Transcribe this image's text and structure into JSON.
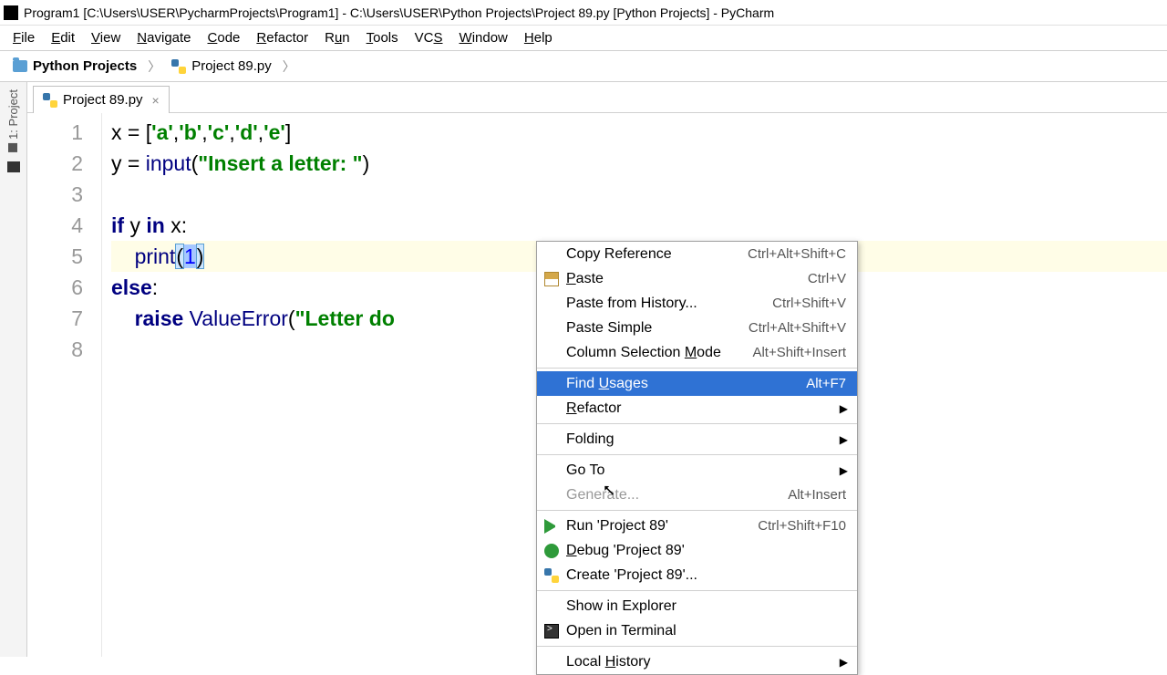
{
  "window": {
    "title": "Program1 [C:\\Users\\USER\\PycharmProjects\\Program1] - C:\\Users\\USER\\Python Projects\\Project 89.py [Python Projects] - PyCharm"
  },
  "menubar": {
    "file": "File",
    "edit": "Edit",
    "view": "View",
    "navigate": "Navigate",
    "code": "Code",
    "refactor": "Refactor",
    "run": "Run",
    "tools": "Tools",
    "vcs": "VCS",
    "window": "Window",
    "help": "Help"
  },
  "breadcrumb": {
    "folder": "Python Projects",
    "file": "Project 89.py"
  },
  "sidebar": {
    "label": "1: Project"
  },
  "tab": {
    "name": "Project 89.py"
  },
  "code": {
    "l1_pre": "x = [",
    "l1_a": "'a'",
    "l1_b": "'b'",
    "l1_c": "'c'",
    "l1_d": "'d'",
    "l1_e": "'e'",
    "l1_post": "]",
    "l2_pre": "y = ",
    "l2_fn": "input",
    "l2_open": "(",
    "l2_str": "\"Insert a letter: \"",
    "l2_close": ")",
    "l4_if": "if ",
    "l4_rest": "y ",
    "l4_in": "in ",
    "l4_x": "x:",
    "l5_indent": "    ",
    "l5_fn": "print",
    "l5_open": "(",
    "l5_num": "1",
    "l5_close": ")",
    "l6": "else",
    "l6_colon": ":",
    "l7_indent": "    ",
    "l7_raise": "raise ",
    "l7_err": "ValueError",
    "l7_open": "(",
    "l7_str": "\"Letter do"
  },
  "line_numbers": {
    "n1": "1",
    "n2": "2",
    "n3": "3",
    "n4": "4",
    "n5": "5",
    "n6": "6",
    "n7": "7",
    "n8": "8"
  },
  "context_menu": {
    "copy_ref": "Copy Reference",
    "copy_ref_sc": "Ctrl+Alt+Shift+C",
    "paste": "Paste",
    "paste_sc": "Ctrl+V",
    "paste_hist": "Paste from History...",
    "paste_hist_sc": "Ctrl+Shift+V",
    "paste_simple": "Paste Simple",
    "paste_simple_sc": "Ctrl+Alt+Shift+V",
    "col_sel": "Column Selection Mode",
    "col_sel_sc": "Alt+Shift+Insert",
    "find_usages": "Find Usages",
    "find_usages_sc": "Alt+F7",
    "refactor": "Refactor",
    "folding": "Folding",
    "goto": "Go To",
    "generate": "Generate...",
    "generate_sc": "Alt+Insert",
    "run": "Run 'Project 89'",
    "run_sc": "Ctrl+Shift+F10",
    "debug": "Debug 'Project 89'",
    "create": "Create 'Project 89'...",
    "show_explorer": "Show in Explorer",
    "open_terminal": "Open in Terminal",
    "local_history": "Local History"
  }
}
